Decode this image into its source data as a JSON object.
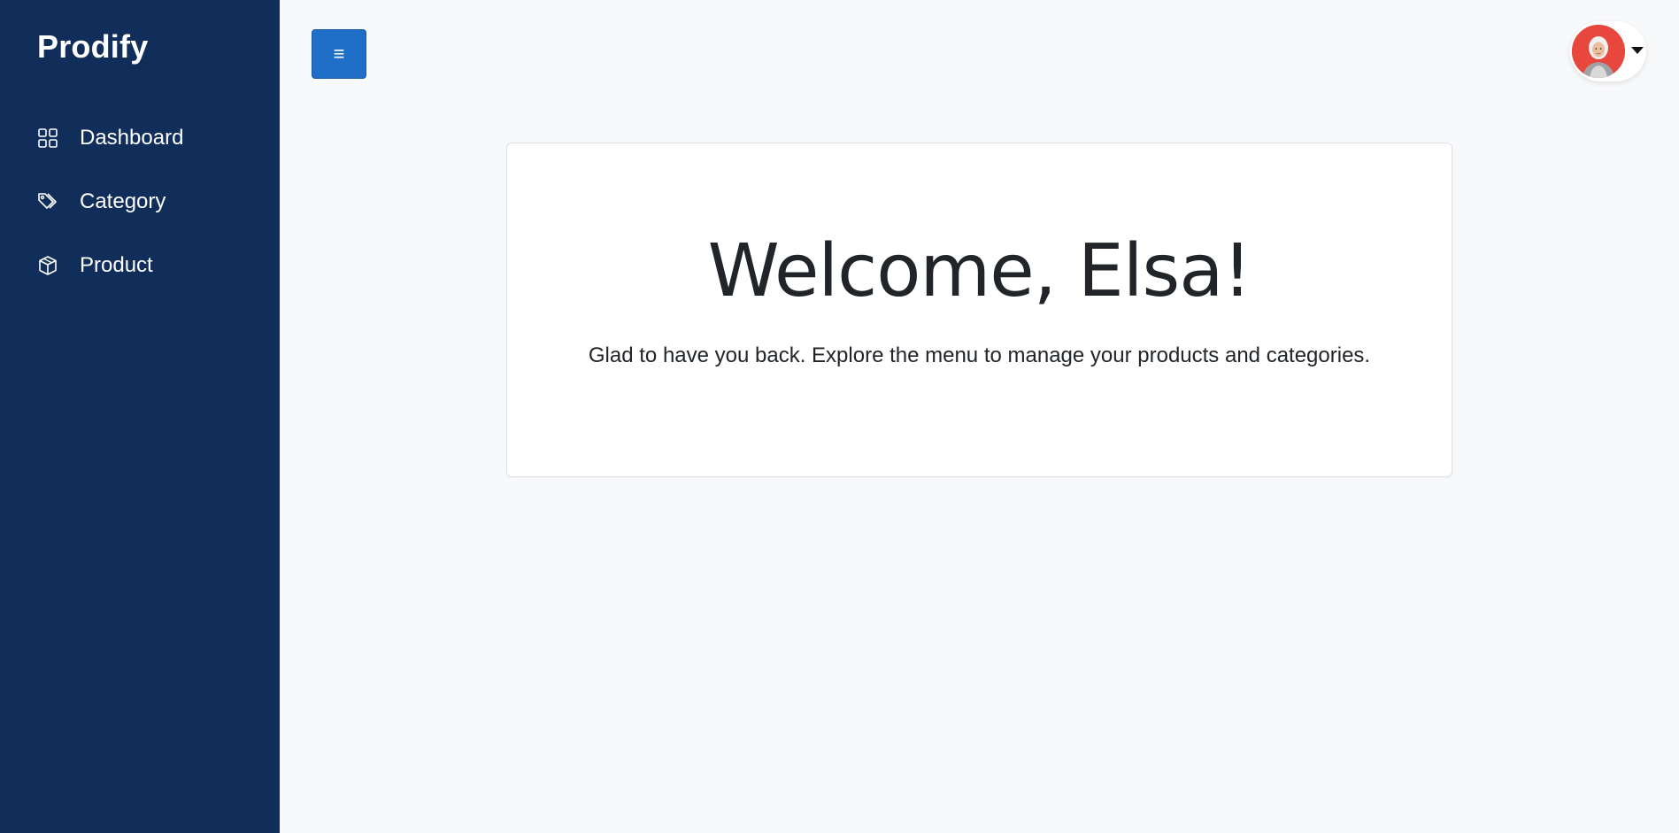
{
  "sidebar": {
    "brand": "Prodify",
    "items": [
      {
        "label": "Dashboard",
        "icon": "dashboard-grid-icon"
      },
      {
        "label": "Category",
        "icon": "tag-icon"
      },
      {
        "label": "Product",
        "icon": "box-icon"
      }
    ]
  },
  "header": {
    "menu_toggle_label": "≡",
    "profile": {
      "avatar_icon": "user-avatar",
      "dropdown_icon": "caret-down-icon"
    }
  },
  "main": {
    "welcome_title": "Welcome, Elsa!",
    "welcome_text": "Glad to have you back. Explore the menu to manage your products and categories."
  },
  "colors": {
    "sidebar_bg": "#112e5a",
    "accent": "#1f6fc8",
    "page_bg": "#f8f9fa",
    "avatar_bg": "#e8473e"
  }
}
